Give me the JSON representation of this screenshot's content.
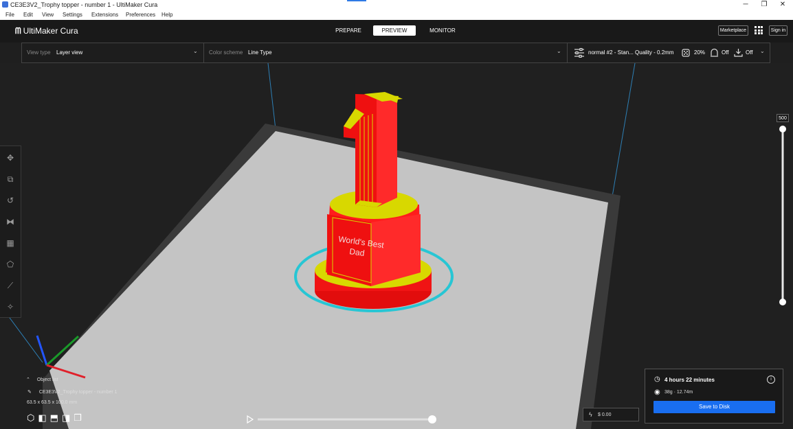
{
  "window": {
    "title": "CE3E3V2_Trophy topper - number 1 - UltiMaker Cura",
    "minimize": "─",
    "maximize": "❐",
    "close": "✕"
  },
  "menu": [
    "File",
    "Edit",
    "View",
    "Settings",
    "Extensions",
    "Preferences",
    "Help"
  ],
  "header": {
    "logo_text": "UltiMaker Cura",
    "stages": [
      "PREPARE",
      "PREVIEW",
      "MONITOR"
    ],
    "active_stage": "PREVIEW",
    "marketplace": "Marketplace",
    "sign_in": "Sign in"
  },
  "toolbar": {
    "view_type_label": "View type",
    "view_type_value": "Layer view",
    "color_scheme_label": "Color scheme",
    "color_scheme_value": "Line Type",
    "profile": "normal #2 - Stan... Quality - 0.2mm",
    "infill": "20%",
    "support": "Off",
    "adhesion": "Off"
  },
  "layer_slider": {
    "value": "500",
    "level": 1.0
  },
  "object_list": {
    "header": "Object list",
    "item": "CE3E3V2_Trophy topper - number 1",
    "dimensions": "63.5 x 63.5 x 100.0 mm"
  },
  "simulation": {
    "progress": 1.0
  },
  "cost": {
    "value": "$ 0.00"
  },
  "print_info": {
    "time": "4 hours 22 minutes",
    "material": "38g · 12.74m",
    "save_button": "Save to Disk"
  },
  "model_text": {
    "line1": "World's Best",
    "line2": "Dad"
  },
  "colors": {
    "accent": "#196ef0",
    "model_wall": "#ff1a1a",
    "model_top": "#d8d800",
    "skirt": "#27c6d4",
    "build_plate": "#c6c6c6"
  }
}
